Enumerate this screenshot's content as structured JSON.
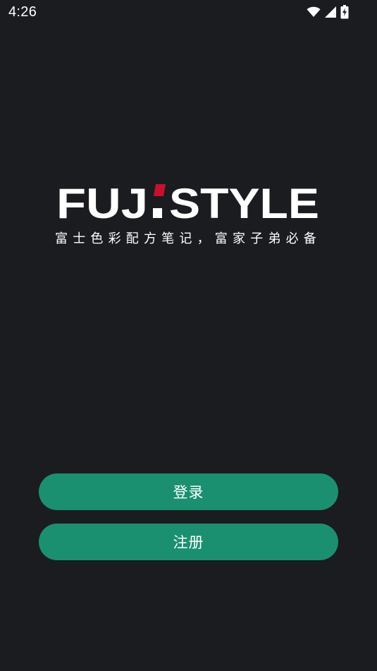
{
  "status_bar": {
    "time": "4:26",
    "icons": [
      "wifi-icon",
      "cell-signal-icon",
      "battery-charging-icon"
    ]
  },
  "brand": {
    "logo_text_left": "FUJ",
    "logo_text_right": "STYLE",
    "tagline": "富士色彩配方笔记，富家子弟必备",
    "accent_color": "#c8102e"
  },
  "actions": {
    "login_label": "登录",
    "register_label": "注册",
    "button_color": "#1a9070"
  },
  "theme": {
    "background": "#1b1c1f"
  }
}
